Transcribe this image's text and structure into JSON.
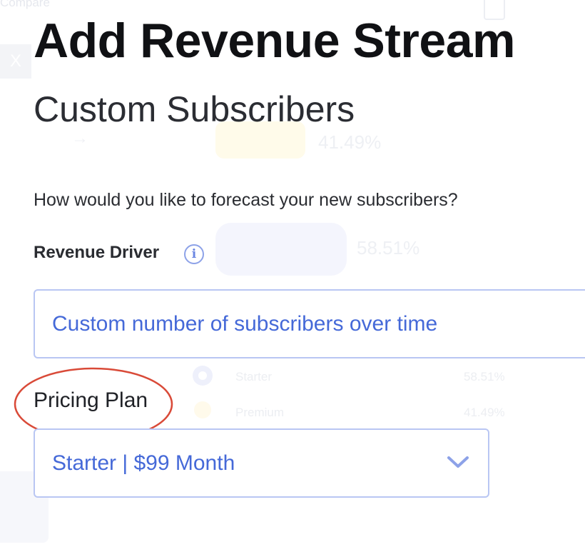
{
  "background": {
    "compare_text": "Compare",
    "close_glyph": "X",
    "percent_top": "41.49%",
    "percent_mid": "58.51%",
    "rows": [
      {
        "name": "Starter",
        "percent": "58.51%"
      },
      {
        "name": "Premium",
        "percent": "41.49%"
      }
    ]
  },
  "modal": {
    "title": "Add Revenue Stream",
    "subtitle": "Custom Subscribers",
    "question": "How would you like to forecast your new subscribers?",
    "revenue_driver": {
      "label": "Revenue Driver",
      "info_icon": "info-icon",
      "value": "Custom number of subscribers over time"
    },
    "pricing_plan": {
      "label": "Pricing Plan",
      "selected": "Starter | $99 Month",
      "dropdown_icon": "chevron-down-icon"
    }
  },
  "colors": {
    "accent": "#4569d8",
    "field_border": "#b9c6f3",
    "annotation": "#d94a38"
  }
}
